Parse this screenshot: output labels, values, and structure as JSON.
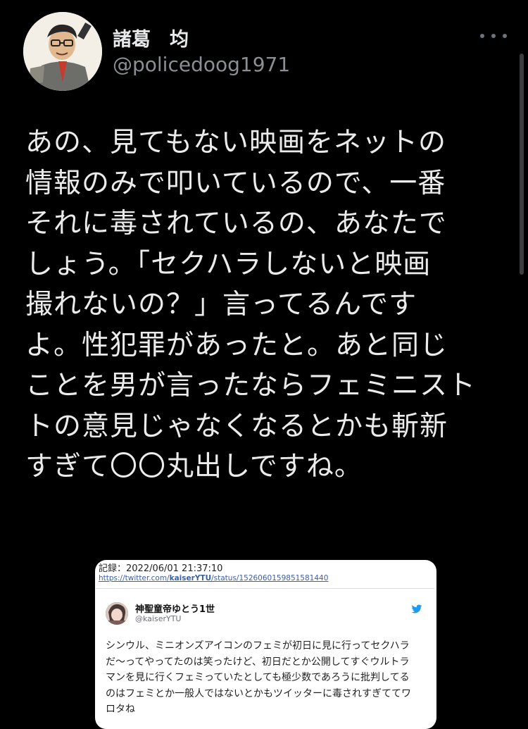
{
  "author": {
    "display_name": "諸葛　均",
    "handle": "@policedoog1971"
  },
  "tweet": {
    "lines": [
      "あの、見てもない映画をネットの",
      "情報のみで叩いているので、一番",
      "それに毒されているの、あなたで",
      "しょう。「セクハラしないと映画",
      "撮れないの？」言ってるんです",
      "よ。性犯罪があったと。あと同じ",
      "ことを男が言ったならフェミニスト",
      "トの意見じゃなくなるとかも斬新",
      "すぎて〇〇丸出しですね。"
    ]
  },
  "embedded_capture": {
    "record_label": "記録：2022/06/01 21:37:10",
    "url_prefix": "https://twitter.com/",
    "url_user": "kaiserYTU",
    "url_suffix": "/status/1526060159851581440",
    "quoted": {
      "display_name": "神聖童帝ゆとう1世",
      "handle": "@kaiserYTU",
      "lines": [
        "シンウル、ミニオンズアイコンのフェミが初日に見に行ってセクハラ",
        "だ〜ってやってたのは笑ったけど、初日だとか公開してすぐウルトラ",
        "マンを見に行くフェミっていたとしても極少数であろうに批判してる",
        "のはフェミとか一般人ではないとかもツイッターに毒されすぎててワ",
        "ロタね"
      ]
    }
  },
  "icons": {
    "more": "more-icon",
    "bird": "twitter-bird-icon"
  },
  "colors": {
    "background": "#000000",
    "text": "#e7e9ea",
    "handle": "#8b8f94",
    "link": "#3a5fa8",
    "bird": "#1d9bf0"
  }
}
